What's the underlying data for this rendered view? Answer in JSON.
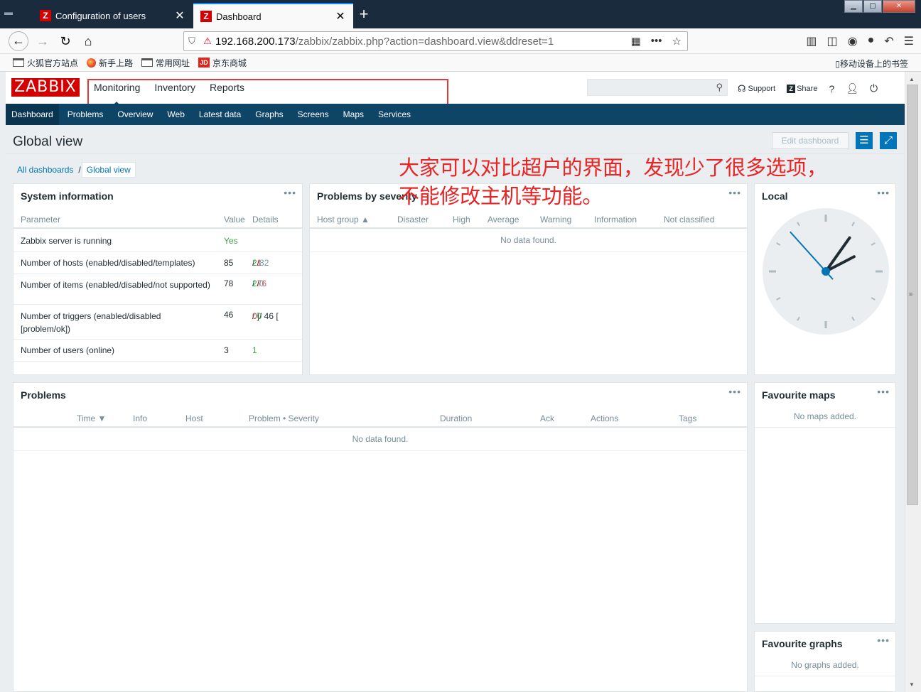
{
  "browser": {
    "tabs": [
      {
        "label": "Configuration of users",
        "icon": "Z"
      },
      {
        "label": "Dashboard",
        "icon": "Z"
      }
    ],
    "url_host": "192.168.200.173",
    "url_path": "/zabbix/zabbix.php?action=dashboard.view&ddreset=1",
    "bookmarks": [
      "火狐官方站点",
      "新手上路",
      "常用网址",
      "京东商城"
    ],
    "bookmark_jd_icon": "JD",
    "mobile_bookmarks": "移动设备上的书签"
  },
  "header": {
    "logo": "ZABBIX",
    "menu": [
      "Monitoring",
      "Inventory",
      "Reports"
    ],
    "links": {
      "support": "Support",
      "share": "Share",
      "help": "?"
    }
  },
  "submenu": [
    "Dashboard",
    "Problems",
    "Overview",
    "Web",
    "Latest data",
    "Graphs",
    "Screens",
    "Maps",
    "Services"
  ],
  "page": {
    "title": "Global view",
    "edit_dashboard": "Edit dashboard",
    "breadcrumb": [
      "All dashboards",
      "Global view"
    ],
    "annotation_line1": "大家可以对比超户的界面，发现少了很多选项，",
    "annotation_line2": "不能修改主机等功能。"
  },
  "system_info": {
    "title": "System information",
    "headers": [
      "Parameter",
      "Value",
      "Details"
    ],
    "rows": [
      {
        "param": "Zabbix server is running",
        "value": "Yes",
        "d1": "",
        "d2": "",
        "d3": ""
      },
      {
        "param": "Number of hosts (enabled/disabled/templates)",
        "value": "85",
        "d1": "2",
        "d2": "1",
        "d3": "82"
      },
      {
        "param": "Number of items (enabled/disabled/not supported)",
        "value": "78",
        "d1": "2",
        "d2": "76",
        "d3": "0"
      },
      {
        "param": "Number of triggers (enabled/disabled [problem/ok])",
        "value": "46",
        "d1": "0 / 46 [",
        "d2": "0",
        "d3": "0"
      },
      {
        "param": "Number of users (online)",
        "value": "3",
        "d1": "1",
        "d2": "",
        "d3": ""
      }
    ]
  },
  "problems_by_severity": {
    "title": "Problems by severity",
    "headers": [
      "Host group ▲",
      "Disaster",
      "High",
      "Average",
      "Warning",
      "Information",
      "Not classified"
    ],
    "empty": "No data found."
  },
  "clock": {
    "title": "Local",
    "time": "2:05:53"
  },
  "problems": {
    "title": "Problems",
    "headers": [
      "Time ▼",
      "Info",
      "Host",
      "Problem • Severity",
      "Duration",
      "Ack",
      "Actions",
      "Tags"
    ],
    "empty": "No data found."
  },
  "favourite_maps": {
    "title": "Favourite maps",
    "empty": "No maps added."
  },
  "favourite_graphs": {
    "title": "Favourite graphs",
    "empty": "No graphs added."
  },
  "widget_menu": "•••",
  "colors": {
    "zabbix_red": "#d40000",
    "nav_blue": "#0e4466",
    "accent": "#0275b8",
    "ok_green": "#429e47",
    "problem_red": "#e45959",
    "annotation_red": "#e82424"
  }
}
